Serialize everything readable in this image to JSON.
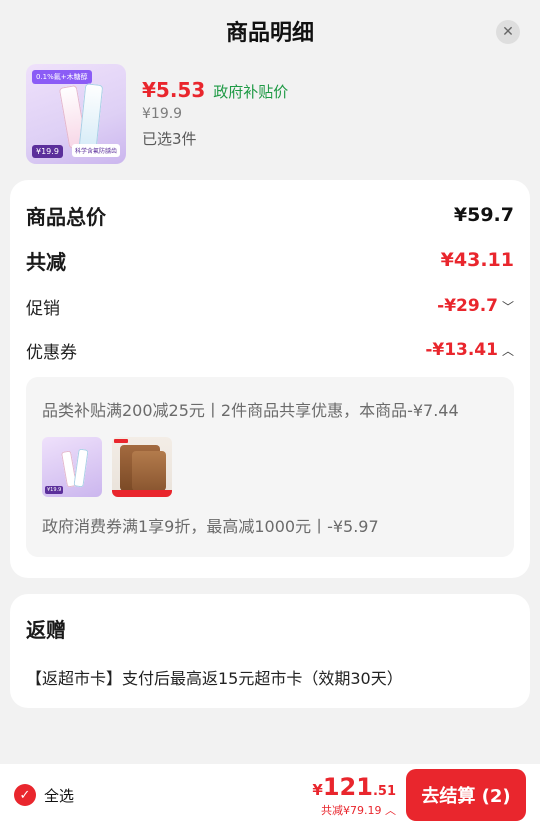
{
  "header": {
    "title": "商品明细",
    "close_icon": "close-icon"
  },
  "product": {
    "price": "¥5.53",
    "gov_label": "政府补贴价",
    "original_price": "¥19.9",
    "selected": "已选3件",
    "thumb": {
      "tag": "0.1%氟+木糖醇",
      "price": "¥19.9",
      "strip": "科学含氟防龋齿"
    }
  },
  "summary": {
    "total_label": "商品总价",
    "total_value": "¥59.7",
    "reduce_label": "共减",
    "reduce_value": "¥43.11",
    "promo_label": "促销",
    "promo_value": "-¥29.7",
    "coupon_label": "优惠券",
    "coupon_value": "-¥13.41",
    "coupon_details": {
      "line1": "品类补贴满200减25元丨2件商品共享优惠，本商品-¥7.44",
      "line2": "政府消费券满1享9折，最高减1000元丨-¥5.97"
    }
  },
  "gift": {
    "title": "返赠",
    "desc": "【返超市卡】支付后最高返15元超市卡（效期30天）"
  },
  "bottom": {
    "select_all": "全选",
    "price_currency": "¥",
    "price_int": "121",
    "price_dec": ".51",
    "saved": "共减¥79.19",
    "checkout": "去结算 (2)"
  },
  "colors": {
    "accent": "#e9262d",
    "gov_green": "#1f9a45"
  }
}
